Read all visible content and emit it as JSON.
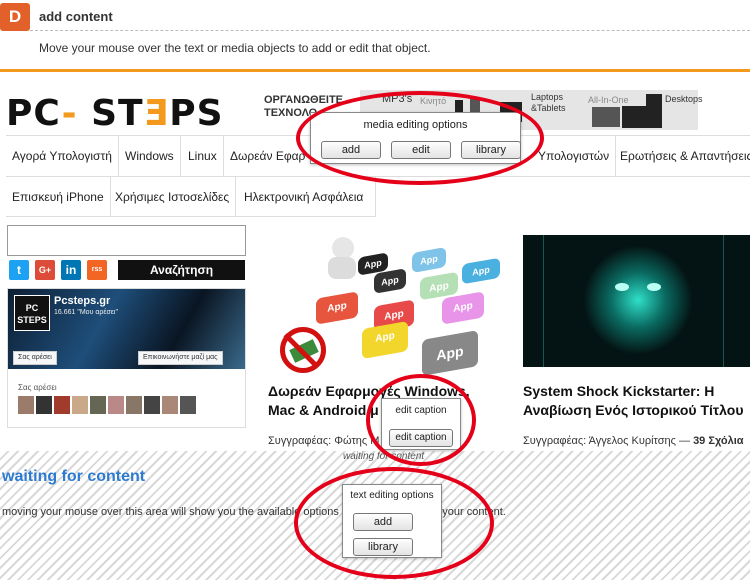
{
  "toolbar": {
    "badge": "D",
    "title": "add content",
    "instruction": "Move your mouse over the text or media objects to add or edit that object."
  },
  "site": {
    "brand_part1": "PC",
    "brand_dash": "-",
    "brand_part2": " ST",
    "brand_e": "Ǝ",
    "brand_part3": "PS",
    "brand_sub1": "ΟΡΓΑΝΩΘΕΙΤΕ",
    "brand_sub2": "ΤΕΧΝΟΛΟ",
    "banner": {
      "mp3": "MP3's",
      "kinito": "Κινητό",
      "laptops": "Laptops",
      "tablets": "&Tablets",
      "allinone": "All-In-One",
      "desktops": "Desktops"
    },
    "nav": [
      "Αγορά Υπολογιστή",
      "Windows",
      "Linux",
      "Δωρεάν Εφαρ",
      "Υπολογιστών",
      "Ερωτήσεις & Απαντήσεις"
    ],
    "nav2": [
      "Επισκευή iPhone",
      "Χρήσιμες Ιστοσελίδες",
      "Ηλεκτρονική Ασφάλεια"
    ],
    "search_button": "Αναζήτηση",
    "social": [
      "t",
      "G+",
      "in",
      "rss"
    ],
    "facebook": {
      "logo_line1": "PC",
      "logo_line2": "STEPS",
      "name": "Pcsteps.gr",
      "likes": "16.661 \"Μου αρέσει\"",
      "like_button": "Σας αρέσει",
      "contact_button": "Επικοινωνήστε μαζί μας",
      "friends_label": "Σας αρέσει"
    },
    "articles": [
      {
        "title_line1": "Δωρεάν Εφαρμογές Windows,",
        "title_line2": "Mac & Android μ",
        "meta": "Συγγραφέας: Φώτης Μ",
        "img_labels": [
          "App",
          "App",
          "App",
          "App",
          "App",
          "App",
          "App",
          "App",
          "App",
          "App"
        ]
      },
      {
        "title_line1": "System Shock Kickstarter: Η",
        "title_line2": "Αναβίωση Ενός Ιστορικού Τίτλου",
        "meta_prefix": "Συγγραφέας: Άγγελος Κυρίτσης — ",
        "meta_comments": "39 Σχόλια"
      }
    ]
  },
  "waiting": {
    "title": "waiting for content",
    "subtitle": "moving your mouse over this area will show you the available options for adding or editing your content.",
    "small_label": "waiting for content"
  },
  "media_popover": {
    "title": "media editing options",
    "buttons": [
      "add",
      "edit",
      "library"
    ]
  },
  "caption_popover": {
    "title": "edit caption",
    "button": "edit caption"
  },
  "text_popover": {
    "title": "text editing options",
    "buttons": [
      "add",
      "library"
    ]
  },
  "colors": {
    "accent_orange": "#f39a1e",
    "badge": "#e2612b",
    "highlight_ring": "#e50019",
    "link_blue": "#2d7bd1"
  }
}
